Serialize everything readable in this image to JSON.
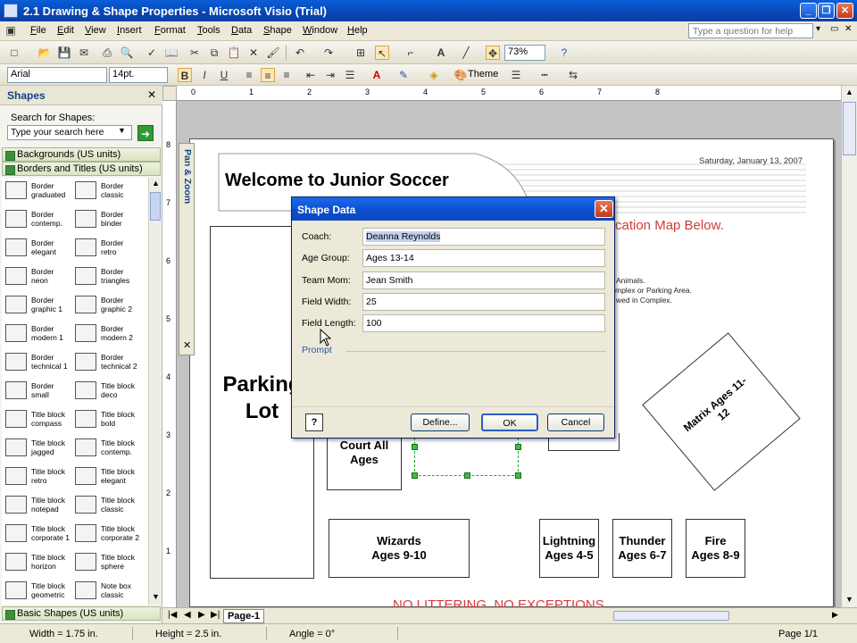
{
  "window": {
    "title": "2.1 Drawing & Shape Properties - Microsoft Visio (Trial)"
  },
  "menu": [
    "File",
    "Edit",
    "View",
    "Insert",
    "Format",
    "Tools",
    "Data",
    "Shape",
    "Window",
    "Help"
  ],
  "help_box": {
    "placeholder": "Type a question for help"
  },
  "toolbar": {
    "zoom": "73%",
    "font": "Arial",
    "font_size": "14pt.",
    "theme_label": "Theme"
  },
  "shapes_pane": {
    "title": "Shapes",
    "search_label": "Search for Shapes:",
    "search_placeholder": "Type your search here",
    "stencils": [
      "Backgrounds (US units)",
      "Borders and Titles (US units)",
      "Basic Shapes (US units)"
    ],
    "items": [
      [
        "Border graduated",
        "Border classic"
      ],
      [
        "Border contemp.",
        "Border binder"
      ],
      [
        "Border elegant",
        "Border retro"
      ],
      [
        "Border neon",
        "Border triangles"
      ],
      [
        "Border graphic 1",
        "Border graphic 2"
      ],
      [
        "Border modern 1",
        "Border modern 2"
      ],
      [
        "Border technical 1",
        "Border technical 2"
      ],
      [
        "Border small",
        "Title block deco"
      ],
      [
        "Title block compass",
        "Title block bold"
      ],
      [
        "Title block jagged",
        "Title block contemp."
      ],
      [
        "Title block retro",
        "Title block elegant"
      ],
      [
        "Title block notepad",
        "Title block classic"
      ],
      [
        "Title block corporate 1",
        "Title block corporate 2"
      ],
      [
        "Title block horizon",
        "Title block sphere"
      ],
      [
        "Title block geometric",
        "Note box classic"
      ]
    ]
  },
  "ruler": {
    "top": [
      "0",
      "1",
      "2",
      "3",
      "4",
      "5",
      "6",
      "7",
      "8"
    ],
    "left": [
      "8",
      "7",
      "6",
      "5",
      "4",
      "3",
      "2",
      "1"
    ]
  },
  "pan_zoom": {
    "label": "Pan & Zoom"
  },
  "drawing": {
    "welcome": "Welcome to Junior Soccer",
    "date": "Saturday, January 13, 2007",
    "location_text": "cation Map Below.",
    "notes": [
      "Animals.",
      "mplex or Parking Area.",
      "wed in Complex."
    ],
    "parking": "Parking Lot",
    "court": "Court All Ages",
    "matrix": "Matrix Ages 11-12",
    "fields": [
      {
        "name": "Wizards",
        "ages": "Ages 9-10"
      },
      {
        "name": "Lightning",
        "ages": "Ages 4-5"
      },
      {
        "name": "Thunder",
        "ages": "Ages 6-7"
      },
      {
        "name": "Fire",
        "ages": "Ages 8-9"
      }
    ],
    "footer": "NO LITTERING, NO EXCEPTIONS"
  },
  "dialog": {
    "title": "Shape Data",
    "fields": [
      {
        "label": "Coach:",
        "value": "Deanna Reynolds"
      },
      {
        "label": "Age Group:",
        "value": "Ages 13-14"
      },
      {
        "label": "Team Mom:",
        "value": "Jean Smith"
      },
      {
        "label": "Field Width:",
        "value": "25"
      },
      {
        "label": "Field Length:",
        "value": "100"
      }
    ],
    "prompt": "Prompt",
    "help": "?",
    "define": "Define...",
    "ok": "OK",
    "cancel": "Cancel"
  },
  "page_tab": "Page-1",
  "status": {
    "width": "Width = 1.75 in.",
    "height": "Height = 2.5 in.",
    "angle": "Angle = 0°",
    "page": "Page 1/1"
  }
}
